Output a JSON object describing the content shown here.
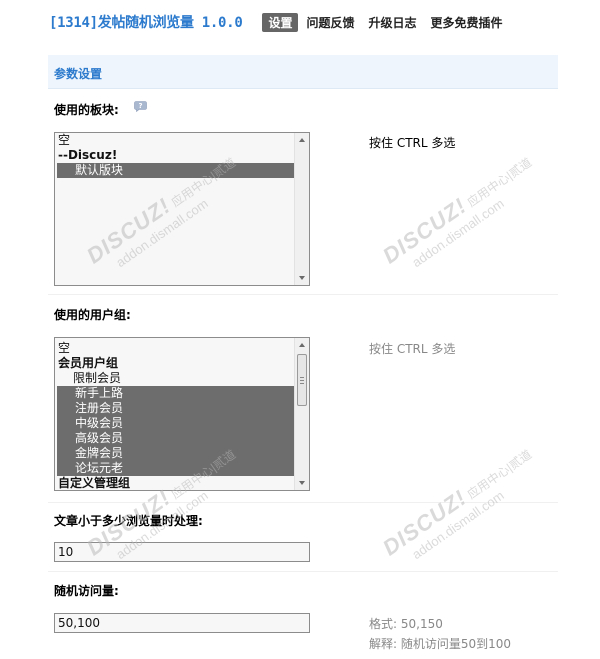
{
  "header": {
    "app_title": "[1314]发帖随机浏览量 1.0.0",
    "tabs": [
      {
        "label": "设置",
        "active": true
      },
      {
        "label": "问题反馈",
        "active": false
      },
      {
        "label": "升级日志",
        "active": false
      },
      {
        "label": "更多免费插件",
        "active": false
      }
    ]
  },
  "section": {
    "title": "参数设置"
  },
  "forums": {
    "label": "使用的板块:",
    "help_icon": "question-bubble-icon",
    "options": [
      {
        "text": "空",
        "type": "plain",
        "selected": false
      },
      {
        "text": "--Discuz!",
        "type": "group",
        "selected": false
      },
      {
        "text": "默认版块",
        "type": "indent",
        "selected": true
      }
    ],
    "tip": "按住 CTRL 多选"
  },
  "usergroups": {
    "label": "使用的用户组:",
    "options": [
      {
        "text": "空",
        "type": "plain",
        "selected": false
      },
      {
        "text": "会员用户组",
        "type": "group",
        "selected": false
      },
      {
        "text": "限制会员",
        "type": "indent",
        "selected": false
      },
      {
        "text": "新手上路",
        "type": "indent",
        "selected": true
      },
      {
        "text": "注册会员",
        "type": "indent",
        "selected": true
      },
      {
        "text": "中级会员",
        "type": "indent",
        "selected": true
      },
      {
        "text": "高级会员",
        "type": "indent",
        "selected": true
      },
      {
        "text": "金牌会员",
        "type": "indent",
        "selected": true
      },
      {
        "text": "论坛元老",
        "type": "indent",
        "selected": true
      },
      {
        "text": "自定义管理组",
        "type": "group",
        "selected": false
      }
    ],
    "tip": "按住 CTRL 多选"
  },
  "views_threshold": {
    "label": "文章小于多少浏览量时处理:",
    "value": "10"
  },
  "random_views": {
    "label": "随机访问量:",
    "value": "50,100",
    "format_tip": "格式: 50,150",
    "explain_tip": "解释: 随机访问量50到100"
  },
  "watermark": {
    "brand": "DISCUZ!",
    "cn_text": "应用中心|贰道",
    "domain": "addon.dismall.com"
  }
}
